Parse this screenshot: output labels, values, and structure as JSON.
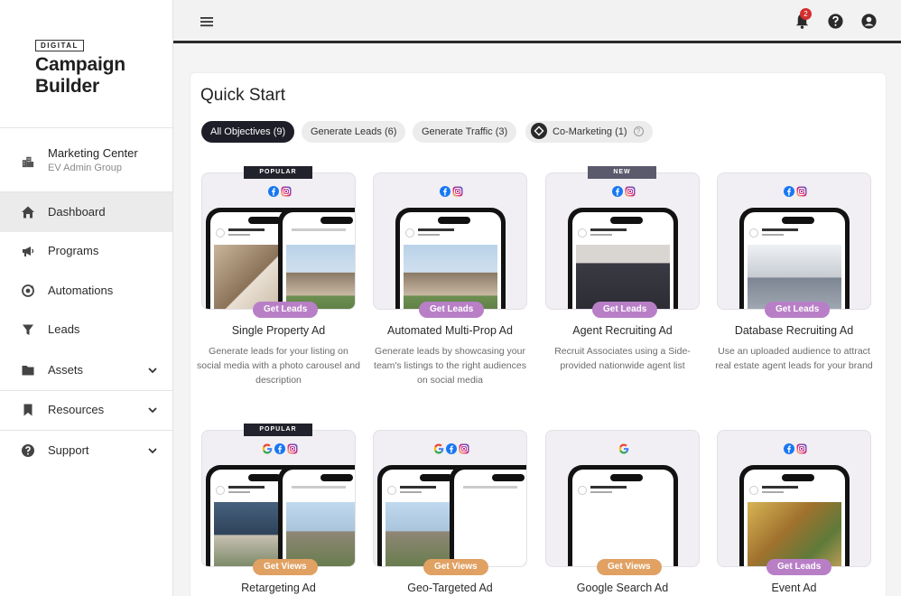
{
  "brand": {
    "tag": "DIGITAL",
    "name_line1": "Campaign",
    "name_line2": "Builder"
  },
  "org": {
    "name": "Marketing Center",
    "group": "EV Admin Group"
  },
  "nav": [
    {
      "label": "Dashboard",
      "icon": "home-icon"
    },
    {
      "label": "Programs",
      "icon": "megaphone-icon"
    },
    {
      "label": "Automations",
      "icon": "automation-icon"
    },
    {
      "label": "Leads",
      "icon": "filter-icon"
    },
    {
      "label": "Assets",
      "icon": "folder-icon"
    },
    {
      "label": "Resources",
      "icon": "bookmark-icon"
    },
    {
      "label": "Support",
      "icon": "help-icon"
    }
  ],
  "topbar": {
    "notification_count": "2"
  },
  "quick_start": {
    "title": "Quick Start",
    "filters": [
      "All Objectives (9)",
      "Generate Leads (6)",
      "Generate Traffic (3)",
      "Co-Marketing (1)"
    ]
  },
  "templates": [
    {
      "ribbon": "POPULAR",
      "cta": "Get Leads",
      "name": "Single Property Ad",
      "desc": "Generate leads for your listing on social media with a photo carousel and description",
      "channels": [
        "facebook",
        "instagram"
      ]
    },
    {
      "ribbon": "",
      "cta": "Get Leads",
      "name": "Automated Multi-Prop Ad",
      "desc": "Generate leads by showcasing your team's listings to the right audiences on social media",
      "channels": [
        "facebook",
        "instagram"
      ]
    },
    {
      "ribbon": "NEW",
      "cta": "Get Leads",
      "name": "Agent Recruiting Ad",
      "desc": "Recruit Associates using a Side-provided nationwide agent list",
      "channels": [
        "facebook",
        "instagram"
      ]
    },
    {
      "ribbon": "",
      "cta": "Get Leads",
      "name": "Database Recruiting Ad",
      "desc": "Use an uploaded audience to attract real estate agent leads for your brand",
      "channels": [
        "facebook",
        "instagram"
      ]
    },
    {
      "ribbon": "POPULAR",
      "cta": "Get Views",
      "name": "Retargeting Ad",
      "desc": "",
      "channels": [
        "google",
        "facebook",
        "instagram"
      ]
    },
    {
      "ribbon": "",
      "cta": "Get Views",
      "name": "Geo-Targeted Ad",
      "desc": "",
      "channels": [
        "google",
        "facebook",
        "instagram"
      ]
    },
    {
      "ribbon": "",
      "cta": "Get Views",
      "name": "Google Search Ad",
      "desc": "",
      "channels": [
        "google"
      ]
    },
    {
      "ribbon": "",
      "cta": "Get Leads",
      "name": "Event Ad",
      "desc": "",
      "channels": [
        "facebook",
        "instagram"
      ]
    }
  ],
  "colors": {
    "leads_cta": "#b87fc7",
    "views_cta": "#e0a163",
    "active_chip": "#1e1e28"
  }
}
